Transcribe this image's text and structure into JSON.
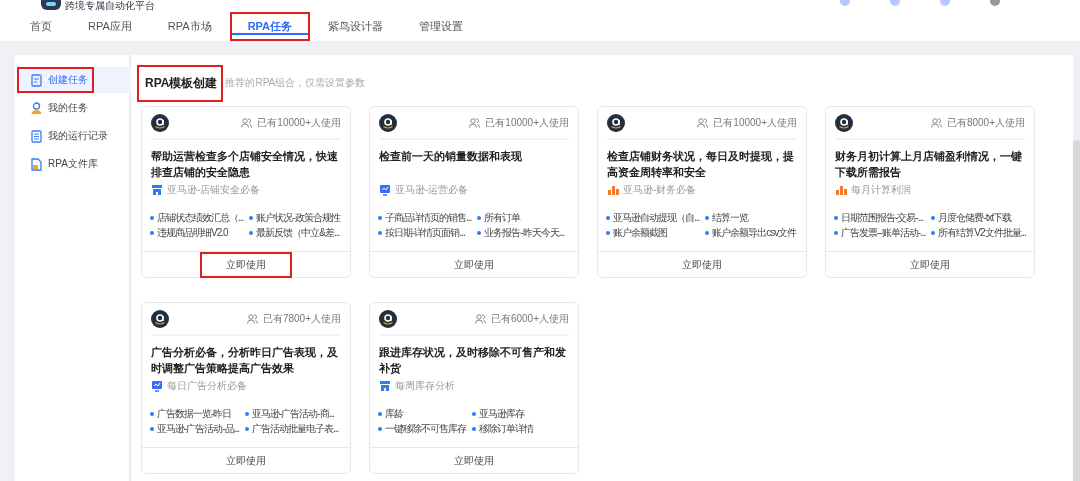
{
  "header": {
    "logo_subtitle": "跨境专属自动化平台"
  },
  "nav": [
    {
      "label": "首页",
      "selected": false,
      "highlighted": false
    },
    {
      "label": "RPA应用",
      "selected": false,
      "highlighted": false
    },
    {
      "label": "RPA市场",
      "selected": false,
      "highlighted": false
    },
    {
      "label": "RPA任务",
      "selected": true,
      "highlighted": true
    },
    {
      "label": "紫鸟设计器",
      "selected": false,
      "highlighted": false
    },
    {
      "label": "管理设置",
      "selected": false,
      "highlighted": false
    }
  ],
  "sidebar": [
    {
      "label": "创建任务",
      "selected": true,
      "highlighted": true
    },
    {
      "label": "我的任务",
      "selected": false,
      "highlighted": false
    },
    {
      "label": "我的运行记录",
      "selected": false,
      "highlighted": false
    },
    {
      "label": "RPA文件库",
      "selected": false,
      "highlighted": false
    }
  ],
  "section": {
    "title": "RPA模板创建",
    "title_highlighted": true,
    "subtitle": "推荐的RPA组合，仅需设置参数"
  },
  "cards": [
    {
      "usage": "已有10000+人使用",
      "title": "帮助运营检查多个店铺安全情况，快速排查店铺的安全隐患",
      "category": "亚马逊-店铺安全必备",
      "items": [
        "店铺状态绩效汇总（...",
        "账户状况-政策合规性",
        "违规商品明细V2.0",
        "最新反馈（中立&差..."
      ],
      "button": "立即使用",
      "button_highlighted": true
    },
    {
      "usage": "已有10000+人使用",
      "title": "检查前一天的销量数据和表现",
      "category": "亚马逊-运营必备",
      "items": [
        "子商品详情页的销售...",
        "所有订单",
        "按日期-详情页面销...",
        "业务报告-昨天今天..."
      ],
      "button": "立即使用",
      "button_highlighted": false
    },
    {
      "usage": "已有10000+人使用",
      "title": "检查店铺财务状况，每日及时提现，提高资金周转率和安全",
      "category": "亚马逊-财务必备",
      "items": [
        "亚马逊自动提现（自...",
        "结算一览",
        "账户余额截图",
        "账户余额导出csv文件"
      ],
      "button": "立即使用",
      "button_highlighted": false
    },
    {
      "usage": "已有8000+人使用",
      "title": "财务月初计算上月店铺盈利情况，一键下载所需报告",
      "category": "每月计算利润",
      "items": [
        "日期范围报告-交易-...",
        "月度仓储费-txt下载",
        "广告发票--账单活动-...",
        "所有结算V2文件批量..."
      ],
      "button": "立即使用",
      "button_highlighted": false
    },
    {
      "usage": "已有7800+人使用",
      "title": "广告分析必备，分析昨日广告表现，及时调整广告策略提高广告效果",
      "category": "每日广告分析必备",
      "items": [
        "广告数据一览-昨日",
        "亚马逊-广告活动-商...",
        "亚马逊-广告活动-品...",
        "广告活动批量电子表..."
      ],
      "button": "立即使用",
      "button_highlighted": false
    },
    {
      "usage": "已有6000+人使用",
      "title": "跟进库存状况，及时移除不可售产和发补货",
      "category": "每周库存分析",
      "items": [
        "库龄",
        "亚马逊库存",
        "一键移除不可售库存",
        "移除订单详情"
      ],
      "button": "立即使用",
      "button_highlighted": false
    }
  ]
}
